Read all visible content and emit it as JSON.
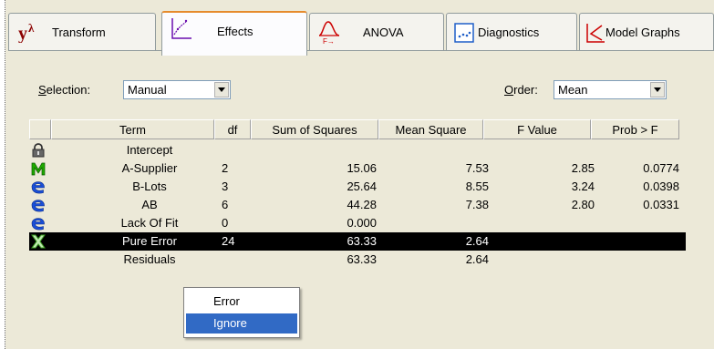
{
  "tabs": [
    {
      "id": "transform",
      "label": "Transform",
      "icon": "y-lambda-icon"
    },
    {
      "id": "effects",
      "label": "Effects",
      "icon": "effects-plot-icon",
      "active": true
    },
    {
      "id": "anova",
      "label": "ANOVA",
      "icon": "f-distribution-icon"
    },
    {
      "id": "diagnostics",
      "label": "Diagnostics",
      "icon": "diagnostics-plot-icon"
    },
    {
      "id": "modelgraphs",
      "label": "Model Graphs",
      "icon": "model-graphs-icon"
    }
  ],
  "selection": {
    "label": "Selection:",
    "value": "Manual"
  },
  "order": {
    "label": "Order:",
    "value": "Mean"
  },
  "table": {
    "headers": [
      "Term",
      "df",
      "Sum of Squares",
      "Mean Square",
      "F Value",
      "Prob > F"
    ],
    "rows": [
      {
        "icon": "lock-icon",
        "term": "Intercept",
        "df": "",
        "ss": "",
        "ms": "",
        "f": "",
        "p": ""
      },
      {
        "icon": "model-m-icon",
        "term": "A-Supplier",
        "df": "2",
        "ss": "15.06",
        "ms": "7.53",
        "f": "2.85",
        "p": "0.0774"
      },
      {
        "icon": "error-e-icon",
        "term": "B-Lots",
        "df": "3",
        "ss": "25.64",
        "ms": "8.55",
        "f": "3.24",
        "p": "0.0398"
      },
      {
        "icon": "error-e-icon",
        "term": "AB",
        "df": "6",
        "ss": "44.28",
        "ms": "7.38",
        "f": "2.80",
        "p": "0.0331"
      },
      {
        "icon": "error-e-icon",
        "term": "Lack Of Fit",
        "df": "0",
        "ss": "0.000",
        "ms": "",
        "f": "",
        "p": ""
      },
      {
        "icon": "ignore-x-icon",
        "term": "Pure Error",
        "df": "24",
        "ss": "63.33",
        "ms": "2.64",
        "f": "",
        "p": "",
        "selected": true
      },
      {
        "icon": "",
        "term": "Residuals",
        "df": "",
        "ss": "63.33",
        "ms": "2.64",
        "f": "",
        "p": ""
      }
    ]
  },
  "context_menu": {
    "items": [
      "Error",
      "Ignore"
    ],
    "highlighted": "Ignore"
  },
  "colors": {
    "selection_bg": "#000000",
    "menu_highlight": "#316ac5",
    "tab_active_accent": "#e68b2c"
  }
}
